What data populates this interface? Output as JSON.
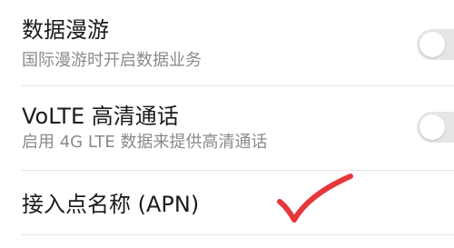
{
  "settings": {
    "items": [
      {
        "title": "数据漫游",
        "subtitle": "国际漫游时开启数据业务",
        "toggle_on": false
      },
      {
        "title": "VoLTE 高清通话",
        "subtitle": "启用 4G LTE 数据来提供高清通话",
        "toggle_on": false
      },
      {
        "title": "接入点名称 (APN)"
      }
    ]
  },
  "annotation": {
    "icon": "checkmark-icon",
    "color": "#e5383b"
  },
  "colors": {
    "title_text": "#1b1b1b",
    "subtitle_text": "#8a8a8a",
    "toggle_off_track": "#e6e6e6"
  }
}
